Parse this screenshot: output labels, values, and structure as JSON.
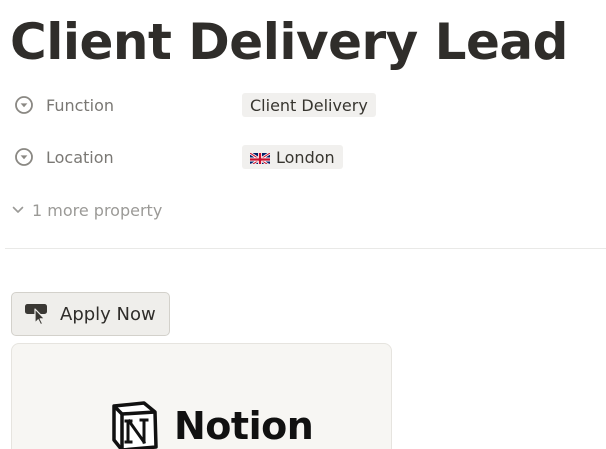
{
  "page": {
    "title": "Client Delivery Lead"
  },
  "properties": [
    {
      "key": "Function",
      "icon": "select-chevron-circle-icon",
      "value": "Client Delivery"
    },
    {
      "key": "Location",
      "icon": "select-chevron-circle-icon",
      "value": "London",
      "value_icon": "uk-flag-icon"
    }
  ],
  "more_properties": {
    "label": "1 more property",
    "icon": "chevron-down-icon"
  },
  "apply_button": {
    "label": "Apply Now",
    "icon": "hand-pointer-icon"
  },
  "embed": {
    "logo_text": "Notion",
    "logo_icon": "notion-logo-icon"
  },
  "colors": {
    "text": "#37352f",
    "muted": "#7a7874",
    "tag_bg": "#f1f0ee",
    "button_bg": "#efeeeb",
    "card_bg": "#f7f6f3"
  }
}
